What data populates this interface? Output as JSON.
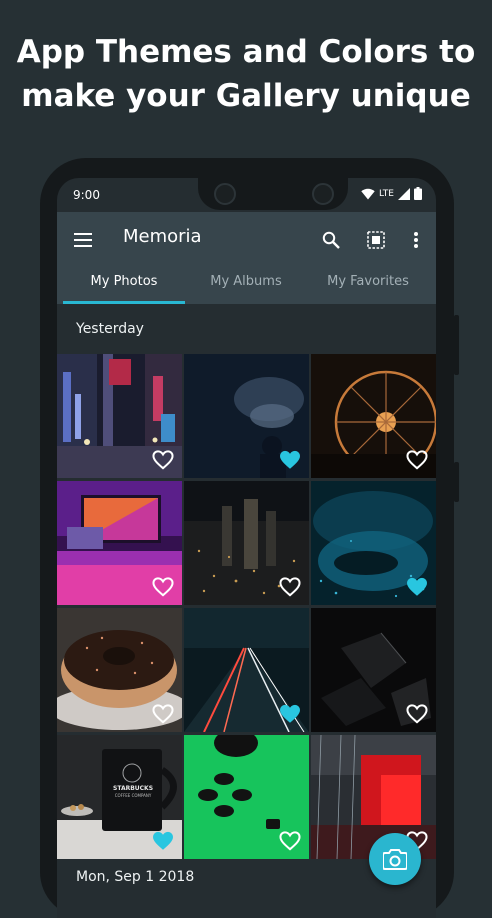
{
  "headline": {
    "line1": "App Themes and Colors to",
    "line2": "make your Gallery unique"
  },
  "status_bar": {
    "time": "9:00",
    "network": "LTE",
    "icons": [
      "wifi-icon",
      "signal-icon",
      "battery-icon"
    ]
  },
  "toolbar": {
    "title": "Memoria",
    "icons": [
      "menu-icon",
      "search-icon",
      "select-all-icon",
      "more-vert-icon"
    ]
  },
  "tabs": [
    {
      "label": "My Photos",
      "active": true
    },
    {
      "label": "My Albums",
      "active": false
    },
    {
      "label": "My Favorites",
      "active": false
    }
  ],
  "sections": [
    {
      "label": "Yesterday"
    },
    {
      "label": "Mon, Sep 1 2018"
    }
  ],
  "photos": [
    {
      "subject": "city street at night",
      "favorite": false
    },
    {
      "subject": "person with smoke",
      "favorite": true
    },
    {
      "subject": "ferris wheel at night",
      "favorite": false
    },
    {
      "subject": "purple desk setup",
      "favorite": false
    },
    {
      "subject": "city skyline at night",
      "favorite": false
    },
    {
      "subject": "blue water droplets",
      "favorite": true
    },
    {
      "subject": "chocolate donut",
      "favorite": false
    },
    {
      "subject": "highway light trails",
      "favorite": true
    },
    {
      "subject": "dark abstract shapes",
      "favorite": false
    },
    {
      "subject": "coffee mug",
      "favorite": true,
      "mug_text": "STARBUCKS",
      "mug_subtext": "COFFEE COMPANY"
    },
    {
      "subject": "green controller buttons",
      "favorite": false
    },
    {
      "subject": "red rain reflections",
      "favorite": false
    }
  ],
  "fab": {
    "icon": "camera-icon"
  },
  "colors": {
    "background": "#263034",
    "toolbar": "#37454c",
    "screen": "#252d31",
    "accent": "#29b8d3",
    "favorite_heart": "#29c6e0"
  }
}
